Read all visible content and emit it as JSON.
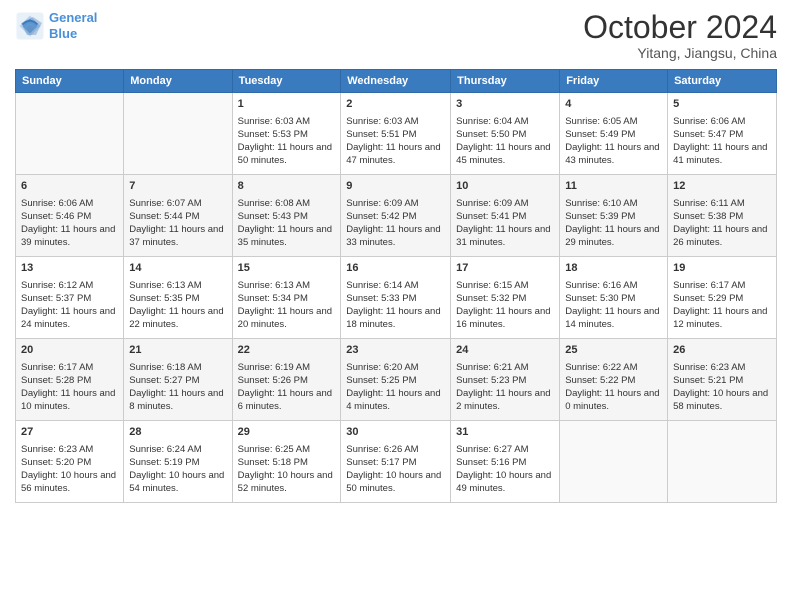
{
  "logo": {
    "line1": "General",
    "line2": "Blue"
  },
  "title": "October 2024",
  "subtitle": "Yitang, Jiangsu, China",
  "weekdays": [
    "Sunday",
    "Monday",
    "Tuesday",
    "Wednesday",
    "Thursday",
    "Friday",
    "Saturday"
  ],
  "weeks": [
    [
      {
        "day": "",
        "sunrise": "",
        "sunset": "",
        "daylight": ""
      },
      {
        "day": "",
        "sunrise": "",
        "sunset": "",
        "daylight": ""
      },
      {
        "day": "1",
        "sunrise": "Sunrise: 6:03 AM",
        "sunset": "Sunset: 5:53 PM",
        "daylight": "Daylight: 11 hours and 50 minutes."
      },
      {
        "day": "2",
        "sunrise": "Sunrise: 6:03 AM",
        "sunset": "Sunset: 5:51 PM",
        "daylight": "Daylight: 11 hours and 47 minutes."
      },
      {
        "day": "3",
        "sunrise": "Sunrise: 6:04 AM",
        "sunset": "Sunset: 5:50 PM",
        "daylight": "Daylight: 11 hours and 45 minutes."
      },
      {
        "day": "4",
        "sunrise": "Sunrise: 6:05 AM",
        "sunset": "Sunset: 5:49 PM",
        "daylight": "Daylight: 11 hours and 43 minutes."
      },
      {
        "day": "5",
        "sunrise": "Sunrise: 6:06 AM",
        "sunset": "Sunset: 5:47 PM",
        "daylight": "Daylight: 11 hours and 41 minutes."
      }
    ],
    [
      {
        "day": "6",
        "sunrise": "Sunrise: 6:06 AM",
        "sunset": "Sunset: 5:46 PM",
        "daylight": "Daylight: 11 hours and 39 minutes."
      },
      {
        "day": "7",
        "sunrise": "Sunrise: 6:07 AM",
        "sunset": "Sunset: 5:44 PM",
        "daylight": "Daylight: 11 hours and 37 minutes."
      },
      {
        "day": "8",
        "sunrise": "Sunrise: 6:08 AM",
        "sunset": "Sunset: 5:43 PM",
        "daylight": "Daylight: 11 hours and 35 minutes."
      },
      {
        "day": "9",
        "sunrise": "Sunrise: 6:09 AM",
        "sunset": "Sunset: 5:42 PM",
        "daylight": "Daylight: 11 hours and 33 minutes."
      },
      {
        "day": "10",
        "sunrise": "Sunrise: 6:09 AM",
        "sunset": "Sunset: 5:41 PM",
        "daylight": "Daylight: 11 hours and 31 minutes."
      },
      {
        "day": "11",
        "sunrise": "Sunrise: 6:10 AM",
        "sunset": "Sunset: 5:39 PM",
        "daylight": "Daylight: 11 hours and 29 minutes."
      },
      {
        "day": "12",
        "sunrise": "Sunrise: 6:11 AM",
        "sunset": "Sunset: 5:38 PM",
        "daylight": "Daylight: 11 hours and 26 minutes."
      }
    ],
    [
      {
        "day": "13",
        "sunrise": "Sunrise: 6:12 AM",
        "sunset": "Sunset: 5:37 PM",
        "daylight": "Daylight: 11 hours and 24 minutes."
      },
      {
        "day": "14",
        "sunrise": "Sunrise: 6:13 AM",
        "sunset": "Sunset: 5:35 PM",
        "daylight": "Daylight: 11 hours and 22 minutes."
      },
      {
        "day": "15",
        "sunrise": "Sunrise: 6:13 AM",
        "sunset": "Sunset: 5:34 PM",
        "daylight": "Daylight: 11 hours and 20 minutes."
      },
      {
        "day": "16",
        "sunrise": "Sunrise: 6:14 AM",
        "sunset": "Sunset: 5:33 PM",
        "daylight": "Daylight: 11 hours and 18 minutes."
      },
      {
        "day": "17",
        "sunrise": "Sunrise: 6:15 AM",
        "sunset": "Sunset: 5:32 PM",
        "daylight": "Daylight: 11 hours and 16 minutes."
      },
      {
        "day": "18",
        "sunrise": "Sunrise: 6:16 AM",
        "sunset": "Sunset: 5:30 PM",
        "daylight": "Daylight: 11 hours and 14 minutes."
      },
      {
        "day": "19",
        "sunrise": "Sunrise: 6:17 AM",
        "sunset": "Sunset: 5:29 PM",
        "daylight": "Daylight: 11 hours and 12 minutes."
      }
    ],
    [
      {
        "day": "20",
        "sunrise": "Sunrise: 6:17 AM",
        "sunset": "Sunset: 5:28 PM",
        "daylight": "Daylight: 11 hours and 10 minutes."
      },
      {
        "day": "21",
        "sunrise": "Sunrise: 6:18 AM",
        "sunset": "Sunset: 5:27 PM",
        "daylight": "Daylight: 11 hours and 8 minutes."
      },
      {
        "day": "22",
        "sunrise": "Sunrise: 6:19 AM",
        "sunset": "Sunset: 5:26 PM",
        "daylight": "Daylight: 11 hours and 6 minutes."
      },
      {
        "day": "23",
        "sunrise": "Sunrise: 6:20 AM",
        "sunset": "Sunset: 5:25 PM",
        "daylight": "Daylight: 11 hours and 4 minutes."
      },
      {
        "day": "24",
        "sunrise": "Sunrise: 6:21 AM",
        "sunset": "Sunset: 5:23 PM",
        "daylight": "Daylight: 11 hours and 2 minutes."
      },
      {
        "day": "25",
        "sunrise": "Sunrise: 6:22 AM",
        "sunset": "Sunset: 5:22 PM",
        "daylight": "Daylight: 11 hours and 0 minutes."
      },
      {
        "day": "26",
        "sunrise": "Sunrise: 6:23 AM",
        "sunset": "Sunset: 5:21 PM",
        "daylight": "Daylight: 10 hours and 58 minutes."
      }
    ],
    [
      {
        "day": "27",
        "sunrise": "Sunrise: 6:23 AM",
        "sunset": "Sunset: 5:20 PM",
        "daylight": "Daylight: 10 hours and 56 minutes."
      },
      {
        "day": "28",
        "sunrise": "Sunrise: 6:24 AM",
        "sunset": "Sunset: 5:19 PM",
        "daylight": "Daylight: 10 hours and 54 minutes."
      },
      {
        "day": "29",
        "sunrise": "Sunrise: 6:25 AM",
        "sunset": "Sunset: 5:18 PM",
        "daylight": "Daylight: 10 hours and 52 minutes."
      },
      {
        "day": "30",
        "sunrise": "Sunrise: 6:26 AM",
        "sunset": "Sunset: 5:17 PM",
        "daylight": "Daylight: 10 hours and 50 minutes."
      },
      {
        "day": "31",
        "sunrise": "Sunrise: 6:27 AM",
        "sunset": "Sunset: 5:16 PM",
        "daylight": "Daylight: 10 hours and 49 minutes."
      },
      {
        "day": "",
        "sunrise": "",
        "sunset": "",
        "daylight": ""
      },
      {
        "day": "",
        "sunrise": "",
        "sunset": "",
        "daylight": ""
      }
    ]
  ]
}
